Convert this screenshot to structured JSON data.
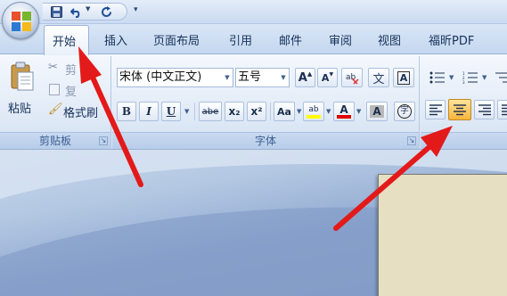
{
  "tabs": [
    {
      "label": "开始"
    },
    {
      "label": "插入"
    },
    {
      "label": "页面布局"
    },
    {
      "label": "引用"
    },
    {
      "label": "邮件"
    },
    {
      "label": "审阅"
    },
    {
      "label": "视图"
    },
    {
      "label": "福昕PDF"
    }
  ],
  "clipboard": {
    "paste_label": "粘贴",
    "cut_label": "剪",
    "copy_label": "复",
    "format_painter_label": "格式刷",
    "group_label": "剪贴板"
  },
  "font": {
    "font_name": "宋体 (中文正文)",
    "font_size": "五号",
    "grow_label": "A",
    "shrink_label": "A",
    "phonetic_label": "文",
    "border_label": "A",
    "bold_label": "B",
    "italic_label": "I",
    "underline_label": "U",
    "strike_label": "abe",
    "sub_label": "x₂",
    "sup_label": "x²",
    "case_label": "Aa",
    "highlight_label": "ab",
    "color_label": "A",
    "shade_label": "A",
    "enclose_label": "字",
    "group_label": "字体"
  },
  "colors": {
    "arrow": "#e31a1a",
    "center_align_active": "#f7b53d",
    "highlight_bar": "#ffff00",
    "font_color_bar": "#e00000"
  }
}
